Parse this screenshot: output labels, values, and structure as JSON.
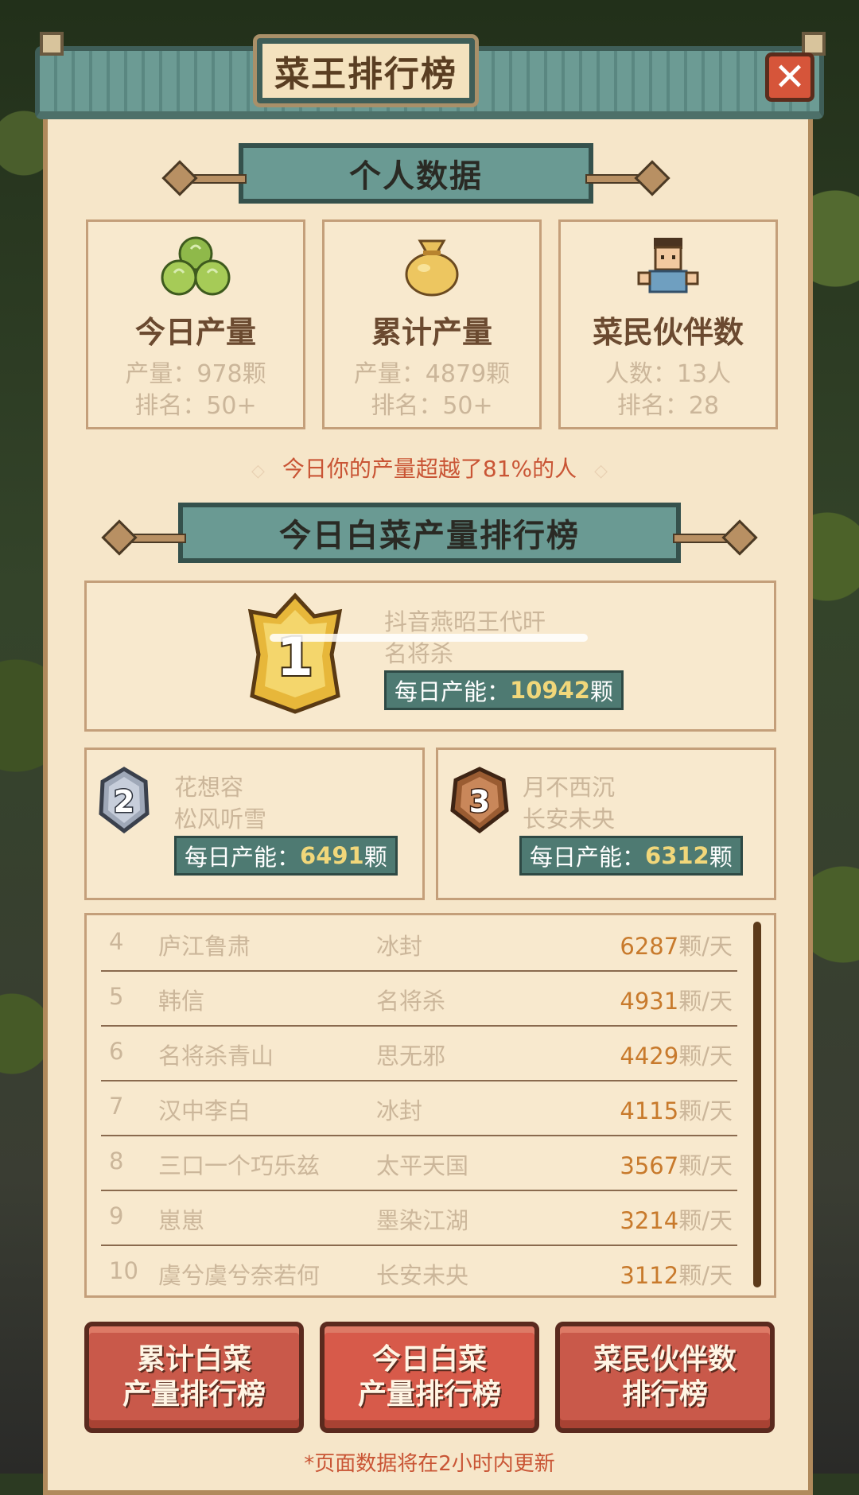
{
  "window": {
    "title": "菜王排行榜",
    "close_icon": "close-icon"
  },
  "personal": {
    "header": "个人数据",
    "cards": [
      {
        "icon": "cabbage-icon",
        "name": "今日产量",
        "line1": "产量：978颗",
        "line2": "排名：50+"
      },
      {
        "icon": "money-bag-icon",
        "name": "累计产量",
        "line1": "产量：4879颗",
        "line2": "排名：50+"
      },
      {
        "icon": "farmer-avatar-icon",
        "name": "菜民伙伴数",
        "line1": "人数：13人",
        "line2": "排名：28"
      }
    ],
    "hint": "今日你的产量超越了81%的人"
  },
  "ranking": {
    "header": "今日白菜产量排行榜",
    "capacity_label": "每日产能：",
    "unit": "颗",
    "top3": [
      {
        "rank": "1",
        "player": "抖音燕昭王代旰",
        "server": "名将杀",
        "value": "10942"
      },
      {
        "rank": "2",
        "player": "花想容",
        "server": "松风听雪",
        "value": "6491"
      },
      {
        "rank": "3",
        "player": "月不西沉",
        "server": "长安未央",
        "value": "6312"
      }
    ],
    "list_unit": "颗/天",
    "rows": [
      {
        "rank": "4",
        "player": "庐江鲁肃",
        "server": "冰封",
        "value": "6287"
      },
      {
        "rank": "5",
        "player": "韩信",
        "server": "名将杀",
        "value": "4931"
      },
      {
        "rank": "6",
        "player": "名将杀青山",
        "server": "思无邪",
        "value": "4429"
      },
      {
        "rank": "7",
        "player": "汉中李白",
        "server": "冰封",
        "value": "4115"
      },
      {
        "rank": "8",
        "player": "三口一个巧乐兹",
        "server": "太平天国",
        "value": "3567"
      },
      {
        "rank": "9",
        "player": "崽崽",
        "server": "墨染江湖",
        "value": "3214"
      },
      {
        "rank": "10",
        "player": "虞兮虞兮奈若何",
        "server": "长安未央",
        "value": "3112"
      }
    ]
  },
  "tabs": [
    {
      "label": "累计白菜\n产量排行榜"
    },
    {
      "label": "今日白菜\n产量排行榜"
    },
    {
      "label": "菜民伙伴数\n排行榜"
    }
  ],
  "footnote": "*页面数据将在2小时内更新",
  "colors": {
    "accent_red": "#c95535",
    "teal": "#6a9a93",
    "panel": "#f6e6c9",
    "gold_value": "#f1d77a"
  }
}
